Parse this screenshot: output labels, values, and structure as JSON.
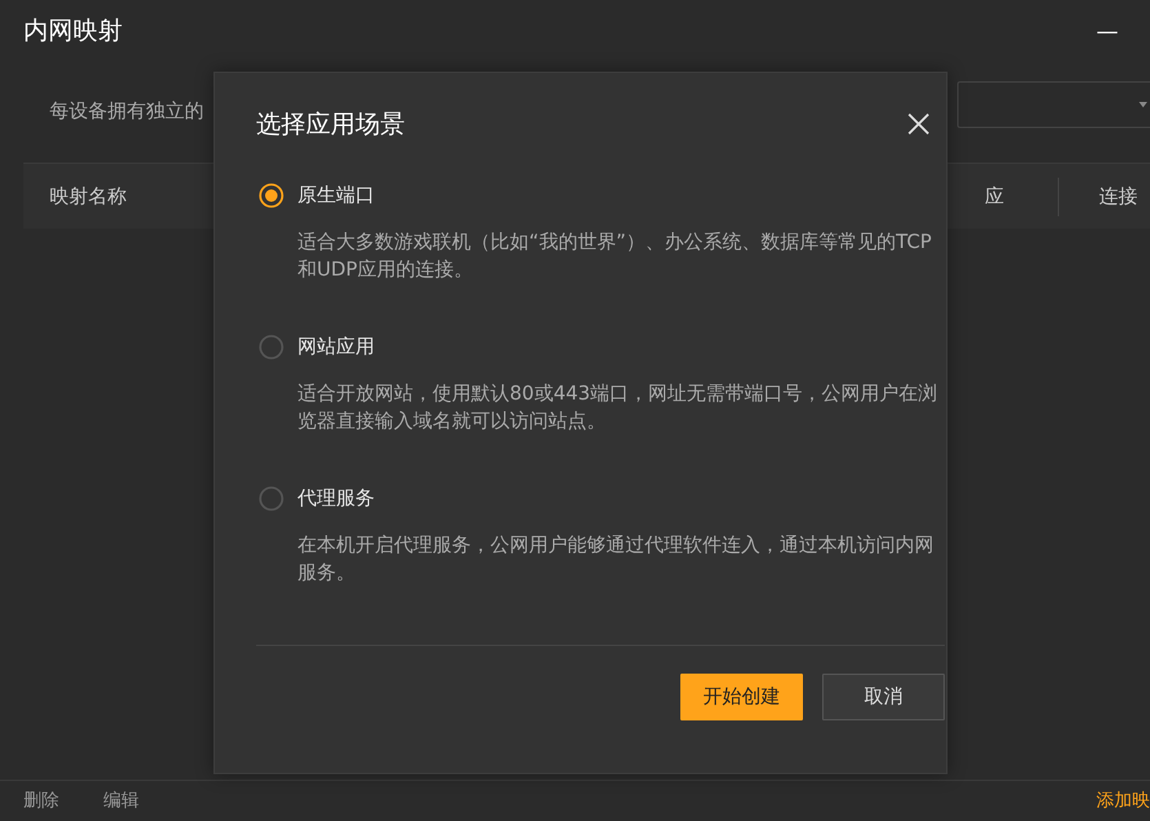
{
  "window": {
    "title": "内网映射",
    "minimize": "—"
  },
  "toolbar": {
    "description": "每设备拥有独立的",
    "dropdown": {
      "open": false
    }
  },
  "table": {
    "columns": [
      "映射名称",
      "应",
      "连接"
    ]
  },
  "footer": {
    "actions": [
      "删除",
      "编辑"
    ],
    "add_link": "添加映"
  },
  "dialog": {
    "title": "选择应用场景",
    "options": [
      {
        "label": "原生端口",
        "description": "适合大多数游戏联机（比如“我的世界”）、办公系统、数据库等常见的TCP和UDP应用的连接。",
        "selected": true
      },
      {
        "label": "网站应用",
        "description": "适合开放网站，使用默认80或443端口，网址无需带端口号，公网用户在浏览器直接输入域名就可以访问站点。",
        "selected": false
      },
      {
        "label": "代理服务",
        "description": "在本机开启代理服务，公网用户能够通过代理软件连入，通过本机访问内网服务。",
        "selected": false
      }
    ],
    "buttons": [
      {
        "label": "开始创建",
        "kind": "primary"
      },
      {
        "label": "取消",
        "kind": "secondary"
      }
    ]
  }
}
